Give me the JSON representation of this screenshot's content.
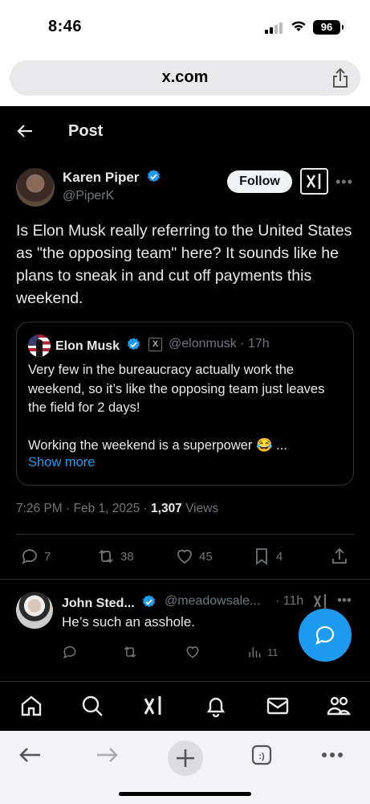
{
  "status_bar": {
    "time": "8:46",
    "battery": "96"
  },
  "browser": {
    "url": "x.com"
  },
  "header": {
    "title": "Post"
  },
  "post": {
    "author_name": "Karen Piper",
    "author_handle": "@PiperK",
    "follow_label": "Follow",
    "text": "Is Elon Musk really referring to the United States as \"the opposing team\" here? It sounds like he plans to sneak in and cut off payments this weekend.",
    "quote": {
      "author_name": "Elon Musk",
      "badge": "X",
      "handle_time": "@elonmusk · 17h",
      "text": "Very few in the bureaucracy actually work the weekend, so it’s like the opposing team just leaves the field for 2 days!\n\nWorking the weekend is a superpower 😂 ...",
      "show_more": "Show more"
    },
    "meta_time": "7:26 PM · Feb 1, 2025 · ",
    "views_count": "1,307",
    "views_label": " Views",
    "actions": {
      "replies": "7",
      "reposts": "38",
      "likes": "45",
      "bookmarks": "4"
    }
  },
  "reply": {
    "author_name": "John Sted...",
    "handle": "@meadowsale...",
    "time": "· 11h",
    "text": "He’s such an asshole.",
    "views": "11"
  },
  "colors": {
    "accent": "#1d9bf0",
    "background": "#000000",
    "secondary_text": "#71767b"
  },
  "icons": [
    "back-arrow-icon",
    "verified-icon",
    "grok-icon",
    "more-icon",
    "reply-icon",
    "repost-icon",
    "like-icon",
    "bookmark-icon",
    "share-icon",
    "views-icon",
    "home-icon",
    "search-icon",
    "notifications-icon",
    "messages-icon",
    "communities-icon",
    "compose-icon"
  ]
}
